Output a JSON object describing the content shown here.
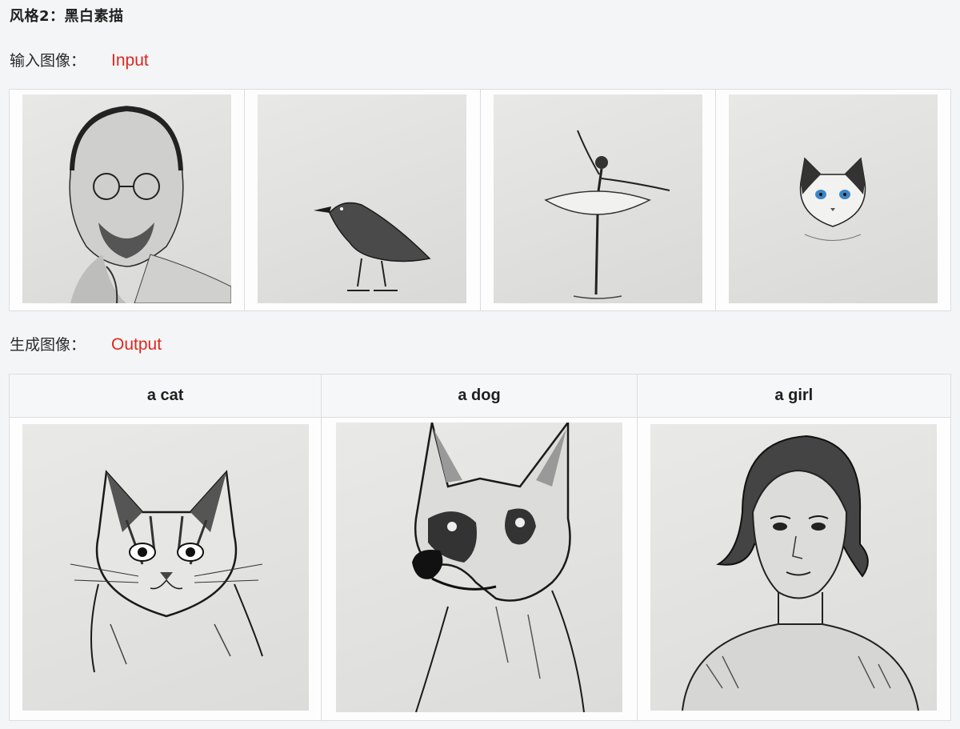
{
  "heading": "风格2：黑白素描",
  "input_section": {
    "label": "输入图像：",
    "tag": "Input",
    "images": [
      {
        "name": "man-portrait-sketch"
      },
      {
        "name": "crow-sketch"
      },
      {
        "name": "ballerina-sketch"
      },
      {
        "name": "cat-blue-eyes-sketch"
      }
    ]
  },
  "output_section": {
    "label": "生成图像：",
    "tag": "Output",
    "columns": [
      {
        "header": "a cat",
        "name": "cat-sketch"
      },
      {
        "header": "a dog",
        "name": "dog-sketch"
      },
      {
        "header": "a girl",
        "name": "girl-sketch"
      }
    ]
  },
  "colors": {
    "tag_red": "#e0271d",
    "page_bg": "#f4f5f7",
    "border": "#dcdde1"
  }
}
